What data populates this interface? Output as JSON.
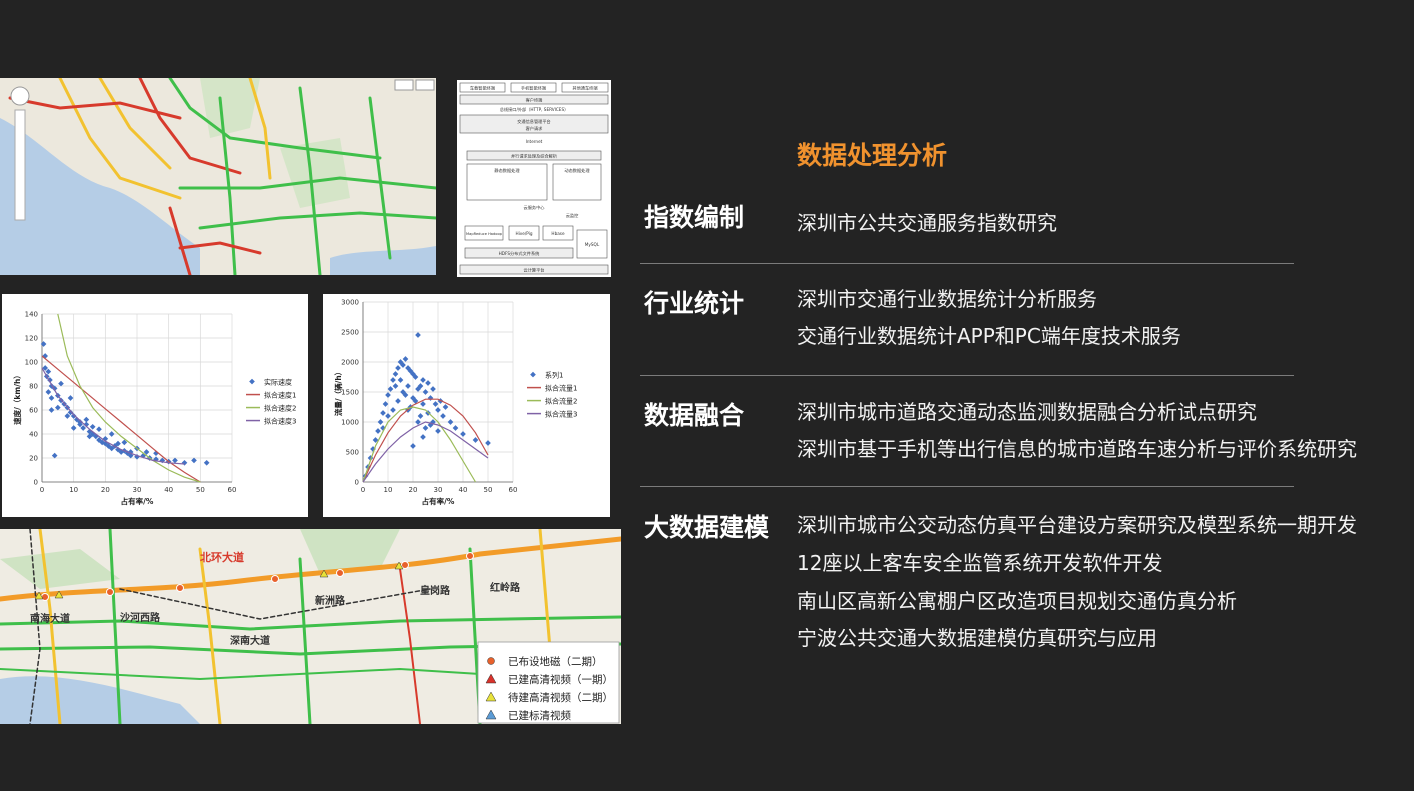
{
  "heading": "数据处理分析",
  "sections": [
    {
      "title": "指数编制",
      "items": [
        "深圳市公共交通服务指数研究"
      ]
    },
    {
      "title": "行业统计",
      "items": [
        "深圳市交通行业数据统计分析服务",
        "交通行业数据统计APP和PC端年度技术服务"
      ]
    },
    {
      "title": "数据融合",
      "items": [
        "深圳市城市道路交通动态监测数据融合分析试点研究",
        "深圳市基于手机等出行信息的城市道路车速分析与评价系统研究"
      ]
    },
    {
      "title": "大数据建模",
      "items": [
        "深圳市城市公交动态仿真平台建设方案研究及模型系统一期开发",
        "12座以上客车安全监管系统开发软件开发",
        "南山区高新公寓棚户区改造项目规划交通仿真分析",
        "宁波公共交通大数据建模仿真研究与应用"
      ]
    }
  ],
  "architecture": {
    "top_terminals": [
      "车载智能终端",
      "手机智能终端",
      "其他通车终端"
    ],
    "client": "客户终端",
    "protocol": "总线接口/外部（HTTP, SERVICES）",
    "platform": "交通信息管理平台",
    "platform_sub": "客户请求",
    "internet": "Internet",
    "parallel": "并行请求处理及综合解析",
    "static_proc": "静态数据处理",
    "dynamic_proc": "动态数据处理",
    "cloud": "云服务中心",
    "monitor": "云监控",
    "mapreduce": "MapReduce Hadoop",
    "hive": "Hive/Pig",
    "hbase": "Hbase",
    "mysql": "MySQL",
    "hdfs": "HDFS分布式文件系统",
    "bottom": "云计算平台"
  },
  "chart_data": [
    {
      "type": "scatter",
      "ylabel": "速度/（km/h）",
      "xlabel": "占有率/%",
      "xlim": [
        0,
        60
      ],
      "ylim": [
        0,
        140
      ],
      "xticks": [
        "0",
        "10",
        "20",
        "30",
        "40",
        "50",
        "60"
      ],
      "yticks": [
        "0",
        "20",
        "40",
        "60",
        "80",
        "100",
        "120",
        "140"
      ],
      "legend_position": "right",
      "series": [
        {
          "name": "实际速度",
          "style": "points",
          "color": "#4472c4",
          "x": [
            0.5,
            1,
            1,
            1.5,
            2,
            2.5,
            3,
            3,
            4,
            5,
            6,
            7,
            8,
            9,
            10,
            11,
            12,
            13,
            14,
            15,
            16,
            17,
            18,
            19,
            20,
            21,
            22,
            23,
            24,
            25,
            26,
            27,
            28,
            30,
            32,
            34,
            36,
            38,
            40,
            42,
            45,
            48,
            52,
            3,
            2,
            5,
            8,
            12,
            15,
            18,
            22,
            26,
            30,
            33,
            36,
            10,
            14,
            20,
            24,
            28,
            6,
            9,
            16,
            4
          ],
          "y": [
            115,
            105,
            95,
            88,
            92,
            85,
            80,
            70,
            78,
            72,
            68,
            65,
            62,
            58,
            55,
            52,
            50,
            45,
            48,
            42,
            40,
            38,
            35,
            33,
            32,
            30,
            28,
            30,
            27,
            25,
            26,
            24,
            22,
            21,
            22,
            20,
            19,
            18,
            17,
            18,
            16,
            18,
            16,
            60,
            75,
            62,
            55,
            48,
            38,
            44,
            40,
            33,
            28,
            25,
            24,
            45,
            52,
            36,
            32,
            25,
            82,
            70,
            46,
            22
          ]
        },
        {
          "name": "拟合速度1",
          "style": "line",
          "color": "#c0504d",
          "x": [
            0,
            5,
            10,
            15,
            20,
            25,
            30,
            35,
            40,
            45,
            50
          ],
          "y": [
            105,
            94,
            83,
            72,
            61,
            50,
            39,
            28,
            17,
            8,
            0
          ]
        },
        {
          "name": "拟合速度2",
          "style": "line",
          "color": "#9bbb59",
          "x": [
            5,
            8,
            12,
            16,
            20,
            25,
            30,
            35,
            40,
            45,
            50
          ],
          "y": [
            140,
            105,
            80,
            62,
            50,
            38,
            28,
            18,
            10,
            4,
            0
          ]
        },
        {
          "name": "拟合速度3",
          "style": "line",
          "color": "#7f62a6",
          "x": [
            0,
            5,
            10,
            15,
            20,
            25,
            30,
            35,
            40,
            45
          ],
          "y": [
            95,
            72,
            56,
            44,
            34,
            27,
            22,
            18,
            16,
            15
          ]
        }
      ]
    },
    {
      "type": "scatter",
      "ylabel": "流量/（辆/h）",
      "xlabel": "占有率/%",
      "xlim": [
        0,
        60
      ],
      "ylim": [
        0,
        3000
      ],
      "xticks": [
        "0",
        "10",
        "20",
        "30",
        "40",
        "50",
        "60"
      ],
      "yticks": [
        "0",
        "500",
        "1000",
        "1500",
        "2000",
        "2500",
        "3000"
      ],
      "legend_position": "right",
      "series": [
        {
          "name": "系列1",
          "style": "points",
          "color": "#4472c4",
          "x": [
            1,
            2,
            3,
            4,
            5,
            6,
            7,
            8,
            9,
            10,
            11,
            12,
            13,
            14,
            15,
            16,
            17,
            18,
            19,
            20,
            21,
            22,
            23,
            24,
            25,
            26,
            27,
            28,
            29,
            30,
            31,
            32,
            33,
            35,
            37,
            40,
            45,
            50,
            12,
            14,
            16,
            18,
            20,
            22,
            24,
            26,
            15,
            17,
            19,
            21,
            23,
            10,
            13,
            25,
            28,
            30,
            8,
            18,
            22,
            27,
            20,
            24
          ],
          "y": [
            100,
            250,
            400,
            550,
            700,
            850,
            1000,
            1150,
            1300,
            1450,
            1550,
            1700,
            1800,
            1900,
            2000,
            1950,
            2050,
            1900,
            1850,
            1800,
            1750,
            2450,
            1600,
            1700,
            1500,
            1650,
            1400,
            1550,
            1300,
            1200,
            1350,
            1100,
            1250,
            1000,
            900,
            800,
            700,
            650,
            1200,
            1350,
            1500,
            1600,
            1400,
            1550,
            1300,
            1150,
            1700,
            1450,
            1250,
            1350,
            1100,
            1100,
            1600,
            900,
            1000,
            850,
            900,
            1200,
            1000,
            950,
            600,
            750
          ]
        },
        {
          "name": "拟合流量1",
          "style": "line",
          "color": "#c0504d",
          "x": [
            0,
            5,
            10,
            15,
            20,
            25,
            30,
            35,
            40,
            45,
            50
          ],
          "y": [
            0,
            450,
            820,
            1100,
            1280,
            1380,
            1380,
            1280,
            1100,
            820,
            450
          ]
        },
        {
          "name": "拟合流量2",
          "style": "line",
          "color": "#9bbb59",
          "x": [
            0,
            5,
            10,
            15,
            20,
            25,
            30,
            35,
            40,
            45
          ],
          "y": [
            0,
            600,
            1000,
            1200,
            1250,
            1200,
            1000,
            700,
            350,
            0
          ]
        },
        {
          "name": "拟合流量3",
          "style": "line",
          "color": "#7f62a6",
          "x": [
            0,
            5,
            10,
            15,
            20,
            25,
            30,
            35,
            40,
            45,
            50
          ],
          "y": [
            0,
            300,
            550,
            750,
            900,
            1000,
            950,
            850,
            700,
            550,
            400
          ]
        }
      ]
    }
  ],
  "map2": {
    "road_labels": [
      "北环大道",
      "南海大道",
      "沙河西路",
      "新洲路",
      "皇岗路",
      "红岭路",
      "深南大道"
    ],
    "legend": [
      {
        "label": "已布设地磁（二期）",
        "symbol": "circle",
        "color": "#e8612c"
      },
      {
        "label": "已建高清视频（一期）",
        "symbol": "triangle",
        "color": "#d9322b"
      },
      {
        "label": "待建高清视频（二期）",
        "symbol": "triangle",
        "color": "#e8e23a"
      },
      {
        "label": "已建标清视频",
        "symbol": "triangle",
        "color": "#5b9bd5"
      }
    ]
  }
}
